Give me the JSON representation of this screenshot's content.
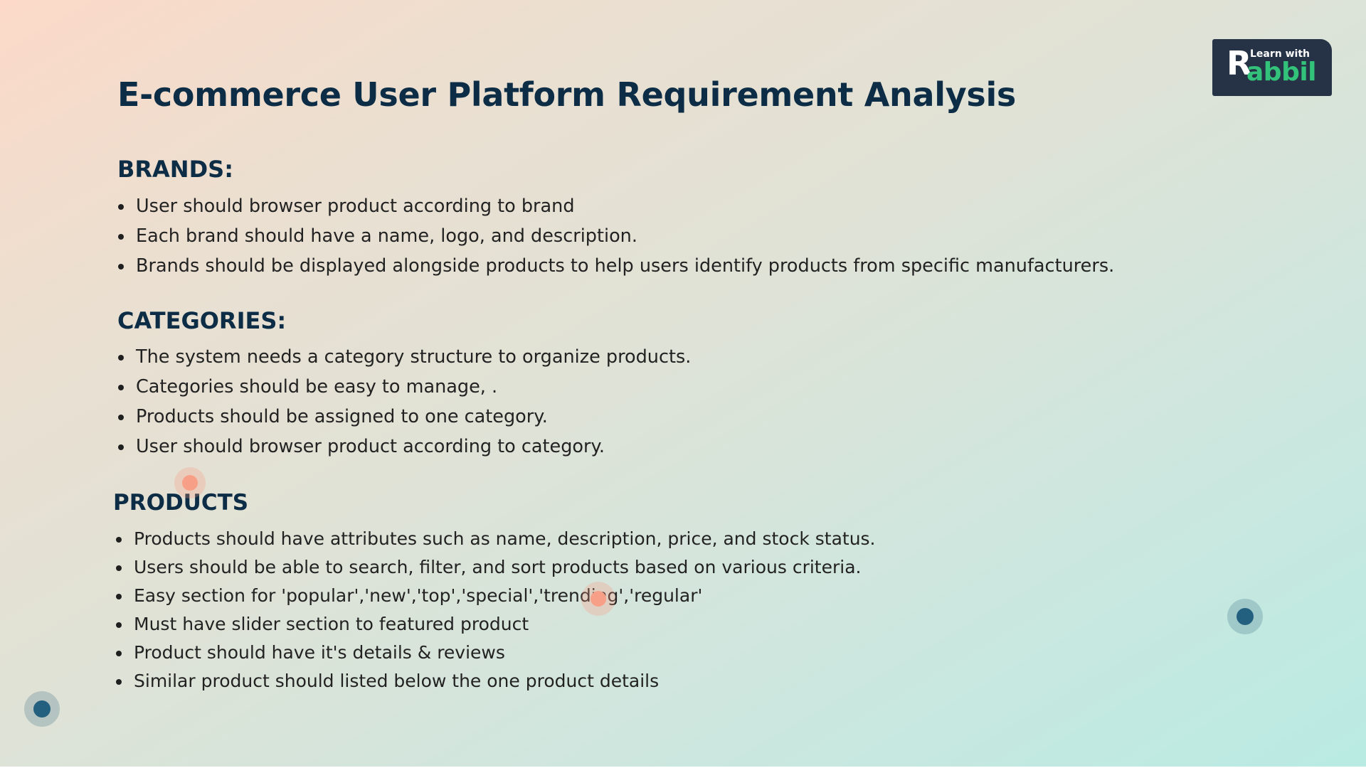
{
  "title": "E-commerce User Platform Requirement Analysis",
  "logo": {
    "letter": "R",
    "top_text": "Learn with",
    "bottom_text": "abbil"
  },
  "sections": [
    {
      "heading": "BRANDS:",
      "items": [
        "User should browser product according to brand",
        "Each brand should have a name, logo, and description.",
        "Brands should be displayed alongside products to help users identify products from specific manufacturers."
      ]
    },
    {
      "heading": "CATEGORIES:",
      "items": [
        "The system needs a category structure to organize products.",
        "Categories should be easy to manage, .",
        "Products should be assigned to one category.",
        "User should browser product according to category."
      ]
    },
    {
      "heading": "PRODUCTS",
      "items": [
        "Products should have attributes such as name, description, price, and stock status.",
        "Users should be able to search, filter, and sort products based on various criteria.",
        "Easy section for  'popular','new','top','special','trending','regular'",
        "Must have slider section to featured product",
        "Product should have it's details & reviews",
        "Similar product should listed below the one product details"
      ]
    }
  ],
  "colors": {
    "heading": "#0c2d45",
    "logo_bg": "#263346",
    "logo_accent": "#33c27a",
    "dot_blue": "#23607f",
    "dot_orange": "#f89f88"
  }
}
